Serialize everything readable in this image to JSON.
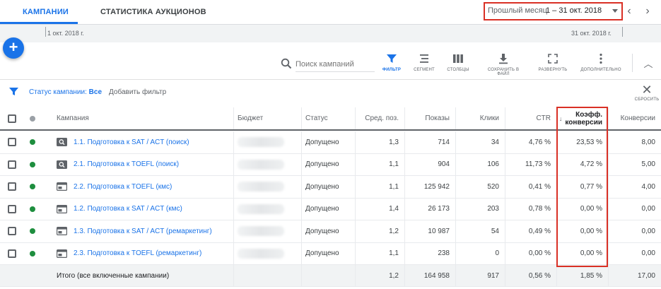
{
  "tabs": [
    {
      "label": "КАМПАНИИ",
      "active": true
    },
    {
      "label": "СТАТИСТИКА АУКЦИОНОВ",
      "active": false
    }
  ],
  "date_picker": {
    "label": "Прошлый месяц",
    "range": "1 – 31 окт. 2018"
  },
  "timeline": {
    "start": "1 окт. 2018 г.",
    "end": "31 окт. 2018 г."
  },
  "fab": {
    "symbol": "+"
  },
  "search": {
    "placeholder": "Поиск кампаний"
  },
  "toolbar": {
    "filter": "ФИЛЬТР",
    "segment": "СЕГМЕНТ",
    "columns": "СТОЛБЦЫ",
    "download": "СОХРАНИТЬ В ФАЙЛ",
    "expand": "РАЗВЕРНУТЬ",
    "more": "ДОПОЛНИТЕЛЬНО"
  },
  "filter_bar": {
    "status_label": "Статус кампании:",
    "status_value": "Все",
    "add_filter": "Добавить фильтр",
    "reset": "СБРОСИТЬ"
  },
  "table": {
    "headers": {
      "campaign": "Кампания",
      "budget": "Бюджет",
      "status": "Статус",
      "avg_pos": "Сред. поз.",
      "impressions": "Показы",
      "clicks": "Клики",
      "ctr": "CTR",
      "conv_rate_1": "Коэфф.",
      "conv_rate_2": "конверсии",
      "conversions": "Конверсии"
    },
    "rows": [
      {
        "icon": "search-campaign-icon",
        "name": "1.1. Подготовка к SAT / ACT (поиск)",
        "status": "Допущено",
        "avg_pos": "1,3",
        "impressions": "714",
        "clicks": "34",
        "ctr": "4,76 %",
        "conv_rate": "23,53 %",
        "conversions": "8,00"
      },
      {
        "icon": "search-campaign-icon",
        "name": "2.1. Подготовка к TOEFL (поиск)",
        "status": "Допущено",
        "avg_pos": "1,1",
        "impressions": "904",
        "clicks": "106",
        "ctr": "11,73 %",
        "conv_rate": "4,72 %",
        "conversions": "5,00"
      },
      {
        "icon": "display-campaign-icon",
        "name": "2.2. Подготовка к TOEFL (кмс)",
        "status": "Допущено",
        "avg_pos": "1,1",
        "impressions": "125 942",
        "clicks": "520",
        "ctr": "0,41 %",
        "conv_rate": "0,77 %",
        "conversions": "4,00"
      },
      {
        "icon": "display-campaign-icon",
        "name": "1.2. Подготовка к SAT / ACT (кмс)",
        "status": "Допущено",
        "avg_pos": "1,4",
        "impressions": "26 173",
        "clicks": "203",
        "ctr": "0,78 %",
        "conv_rate": "0,00 %",
        "conversions": "0,00"
      },
      {
        "icon": "display-campaign-icon",
        "name": "1.3. Подготовка к SAT / ACT (ремаркетинг)",
        "status": "Допущено",
        "avg_pos": "1,2",
        "impressions": "10 987",
        "clicks": "54",
        "ctr": "0,49 %",
        "conv_rate": "0,00 %",
        "conversions": "0,00"
      },
      {
        "icon": "display-campaign-icon",
        "name": "2.3. Подготовка к TOEFL (ремаркетинг)",
        "status": "Допущено",
        "avg_pos": "1,1",
        "impressions": "238",
        "clicks": "0",
        "ctr": "0,00 %",
        "conv_rate": "0,00 %",
        "conversions": "0,00"
      }
    ],
    "total": {
      "label": "Итого (все включенные кампании)",
      "avg_pos": "1,2",
      "impressions": "164 958",
      "clicks": "917",
      "ctr": "0,56 %",
      "conv_rate": "1,85 %",
      "conversions": "17,00"
    }
  },
  "colors": {
    "accent": "#1a73e8",
    "status_green": "#1e8e3e",
    "highlight_red": "#d93025"
  }
}
